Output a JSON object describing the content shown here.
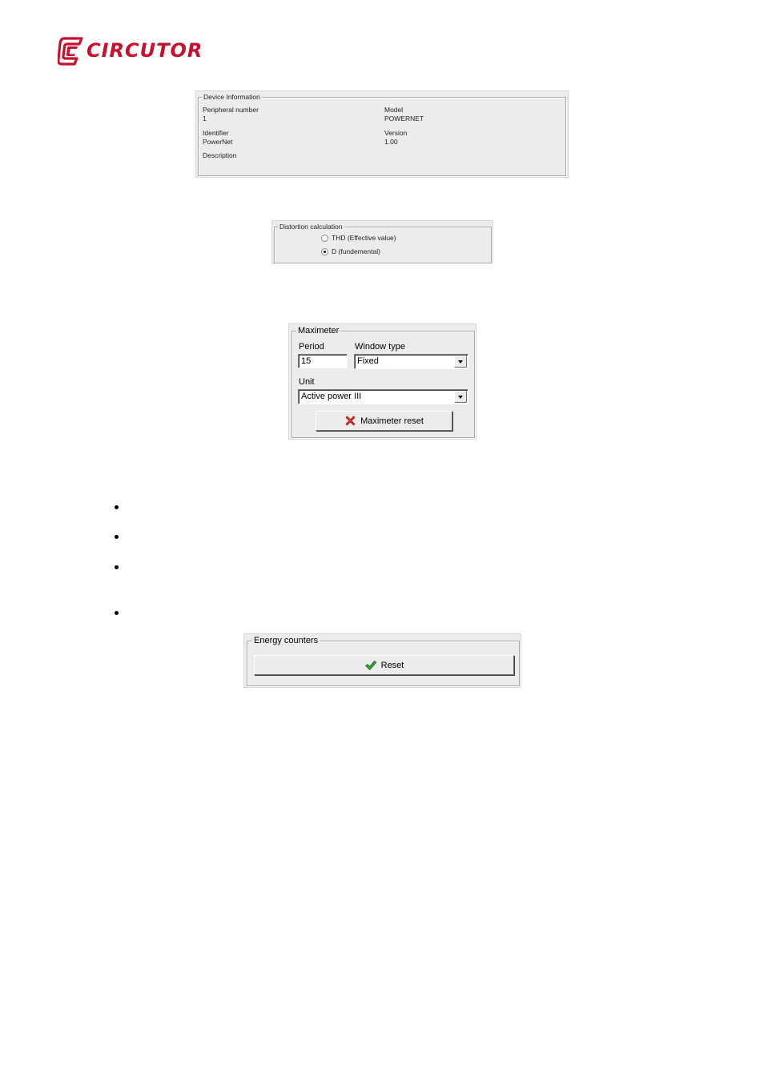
{
  "brand": {
    "name": "CIRCUTOR",
    "color": "#c8102e",
    "logo_icon": "circutor-c-logo-icon"
  },
  "device_info": {
    "legend": "Device Information",
    "peripheral_label": "Peripheral number",
    "peripheral_value": "1",
    "model_label": "Model",
    "model_value": "POWERNET",
    "identifier_label": "Identifier",
    "identifier_value": "PowerNet",
    "version_label": "Version",
    "version_value": "1.00",
    "description_label": "Description"
  },
  "distortion": {
    "legend": "Distortion calculation",
    "options": [
      {
        "label": "THD (Effective value)",
        "selected": false
      },
      {
        "label": "D (fundemental)",
        "selected": true
      }
    ]
  },
  "maximeter": {
    "legend": "Maximeter",
    "period_label": "Period",
    "period_value": "15",
    "window_type_label": "Window type",
    "window_type_value": "Fixed",
    "unit_label": "Unit",
    "unit_value": "Active power III",
    "reset_label": "Maximeter reset",
    "reset_icon": "red-x-icon"
  },
  "bullets": {
    "count": 4
  },
  "energy_counters": {
    "legend": "Energy counters",
    "reset_label": "Reset",
    "reset_icon": "green-check-icon"
  }
}
